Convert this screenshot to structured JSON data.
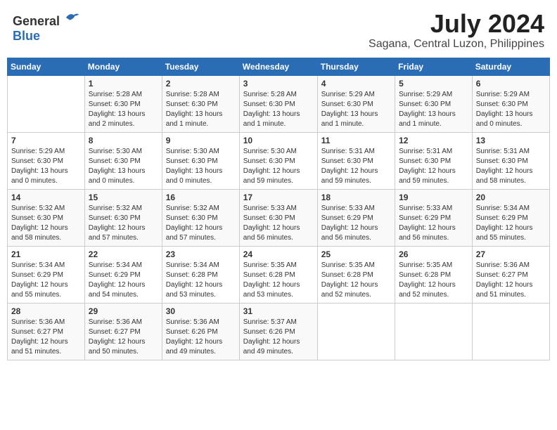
{
  "header": {
    "logo_general": "General",
    "logo_blue": "Blue",
    "month_year": "July 2024",
    "location": "Sagana, Central Luzon, Philippines"
  },
  "days_of_week": [
    "Sunday",
    "Monday",
    "Tuesday",
    "Wednesday",
    "Thursday",
    "Friday",
    "Saturday"
  ],
  "weeks": [
    [
      {
        "day": "",
        "info": ""
      },
      {
        "day": "1",
        "info": "Sunrise: 5:28 AM\nSunset: 6:30 PM\nDaylight: 13 hours\nand 2 minutes."
      },
      {
        "day": "2",
        "info": "Sunrise: 5:28 AM\nSunset: 6:30 PM\nDaylight: 13 hours\nand 1 minute."
      },
      {
        "day": "3",
        "info": "Sunrise: 5:28 AM\nSunset: 6:30 PM\nDaylight: 13 hours\nand 1 minute."
      },
      {
        "day": "4",
        "info": "Sunrise: 5:29 AM\nSunset: 6:30 PM\nDaylight: 13 hours\nand 1 minute."
      },
      {
        "day": "5",
        "info": "Sunrise: 5:29 AM\nSunset: 6:30 PM\nDaylight: 13 hours\nand 1 minute."
      },
      {
        "day": "6",
        "info": "Sunrise: 5:29 AM\nSunset: 6:30 PM\nDaylight: 13 hours\nand 0 minutes."
      }
    ],
    [
      {
        "day": "7",
        "info": "Sunrise: 5:29 AM\nSunset: 6:30 PM\nDaylight: 13 hours\nand 0 minutes."
      },
      {
        "day": "8",
        "info": "Sunrise: 5:30 AM\nSunset: 6:30 PM\nDaylight: 13 hours\nand 0 minutes."
      },
      {
        "day": "9",
        "info": "Sunrise: 5:30 AM\nSunset: 6:30 PM\nDaylight: 13 hours\nand 0 minutes."
      },
      {
        "day": "10",
        "info": "Sunrise: 5:30 AM\nSunset: 6:30 PM\nDaylight: 12 hours\nand 59 minutes."
      },
      {
        "day": "11",
        "info": "Sunrise: 5:31 AM\nSunset: 6:30 PM\nDaylight: 12 hours\nand 59 minutes."
      },
      {
        "day": "12",
        "info": "Sunrise: 5:31 AM\nSunset: 6:30 PM\nDaylight: 12 hours\nand 59 minutes."
      },
      {
        "day": "13",
        "info": "Sunrise: 5:31 AM\nSunset: 6:30 PM\nDaylight: 12 hours\nand 58 minutes."
      }
    ],
    [
      {
        "day": "14",
        "info": "Sunrise: 5:32 AM\nSunset: 6:30 PM\nDaylight: 12 hours\nand 58 minutes."
      },
      {
        "day": "15",
        "info": "Sunrise: 5:32 AM\nSunset: 6:30 PM\nDaylight: 12 hours\nand 57 minutes."
      },
      {
        "day": "16",
        "info": "Sunrise: 5:32 AM\nSunset: 6:30 PM\nDaylight: 12 hours\nand 57 minutes."
      },
      {
        "day": "17",
        "info": "Sunrise: 5:33 AM\nSunset: 6:30 PM\nDaylight: 12 hours\nand 56 minutes."
      },
      {
        "day": "18",
        "info": "Sunrise: 5:33 AM\nSunset: 6:29 PM\nDaylight: 12 hours\nand 56 minutes."
      },
      {
        "day": "19",
        "info": "Sunrise: 5:33 AM\nSunset: 6:29 PM\nDaylight: 12 hours\nand 56 minutes."
      },
      {
        "day": "20",
        "info": "Sunrise: 5:34 AM\nSunset: 6:29 PM\nDaylight: 12 hours\nand 55 minutes."
      }
    ],
    [
      {
        "day": "21",
        "info": "Sunrise: 5:34 AM\nSunset: 6:29 PM\nDaylight: 12 hours\nand 55 minutes."
      },
      {
        "day": "22",
        "info": "Sunrise: 5:34 AM\nSunset: 6:29 PM\nDaylight: 12 hours\nand 54 minutes."
      },
      {
        "day": "23",
        "info": "Sunrise: 5:34 AM\nSunset: 6:28 PM\nDaylight: 12 hours\nand 53 minutes."
      },
      {
        "day": "24",
        "info": "Sunrise: 5:35 AM\nSunset: 6:28 PM\nDaylight: 12 hours\nand 53 minutes."
      },
      {
        "day": "25",
        "info": "Sunrise: 5:35 AM\nSunset: 6:28 PM\nDaylight: 12 hours\nand 52 minutes."
      },
      {
        "day": "26",
        "info": "Sunrise: 5:35 AM\nSunset: 6:28 PM\nDaylight: 12 hours\nand 52 minutes."
      },
      {
        "day": "27",
        "info": "Sunrise: 5:36 AM\nSunset: 6:27 PM\nDaylight: 12 hours\nand 51 minutes."
      }
    ],
    [
      {
        "day": "28",
        "info": "Sunrise: 5:36 AM\nSunset: 6:27 PM\nDaylight: 12 hours\nand 51 minutes."
      },
      {
        "day": "29",
        "info": "Sunrise: 5:36 AM\nSunset: 6:27 PM\nDaylight: 12 hours\nand 50 minutes."
      },
      {
        "day": "30",
        "info": "Sunrise: 5:36 AM\nSunset: 6:26 PM\nDaylight: 12 hours\nand 49 minutes."
      },
      {
        "day": "31",
        "info": "Sunrise: 5:37 AM\nSunset: 6:26 PM\nDaylight: 12 hours\nand 49 minutes."
      },
      {
        "day": "",
        "info": ""
      },
      {
        "day": "",
        "info": ""
      },
      {
        "day": "",
        "info": ""
      }
    ]
  ]
}
